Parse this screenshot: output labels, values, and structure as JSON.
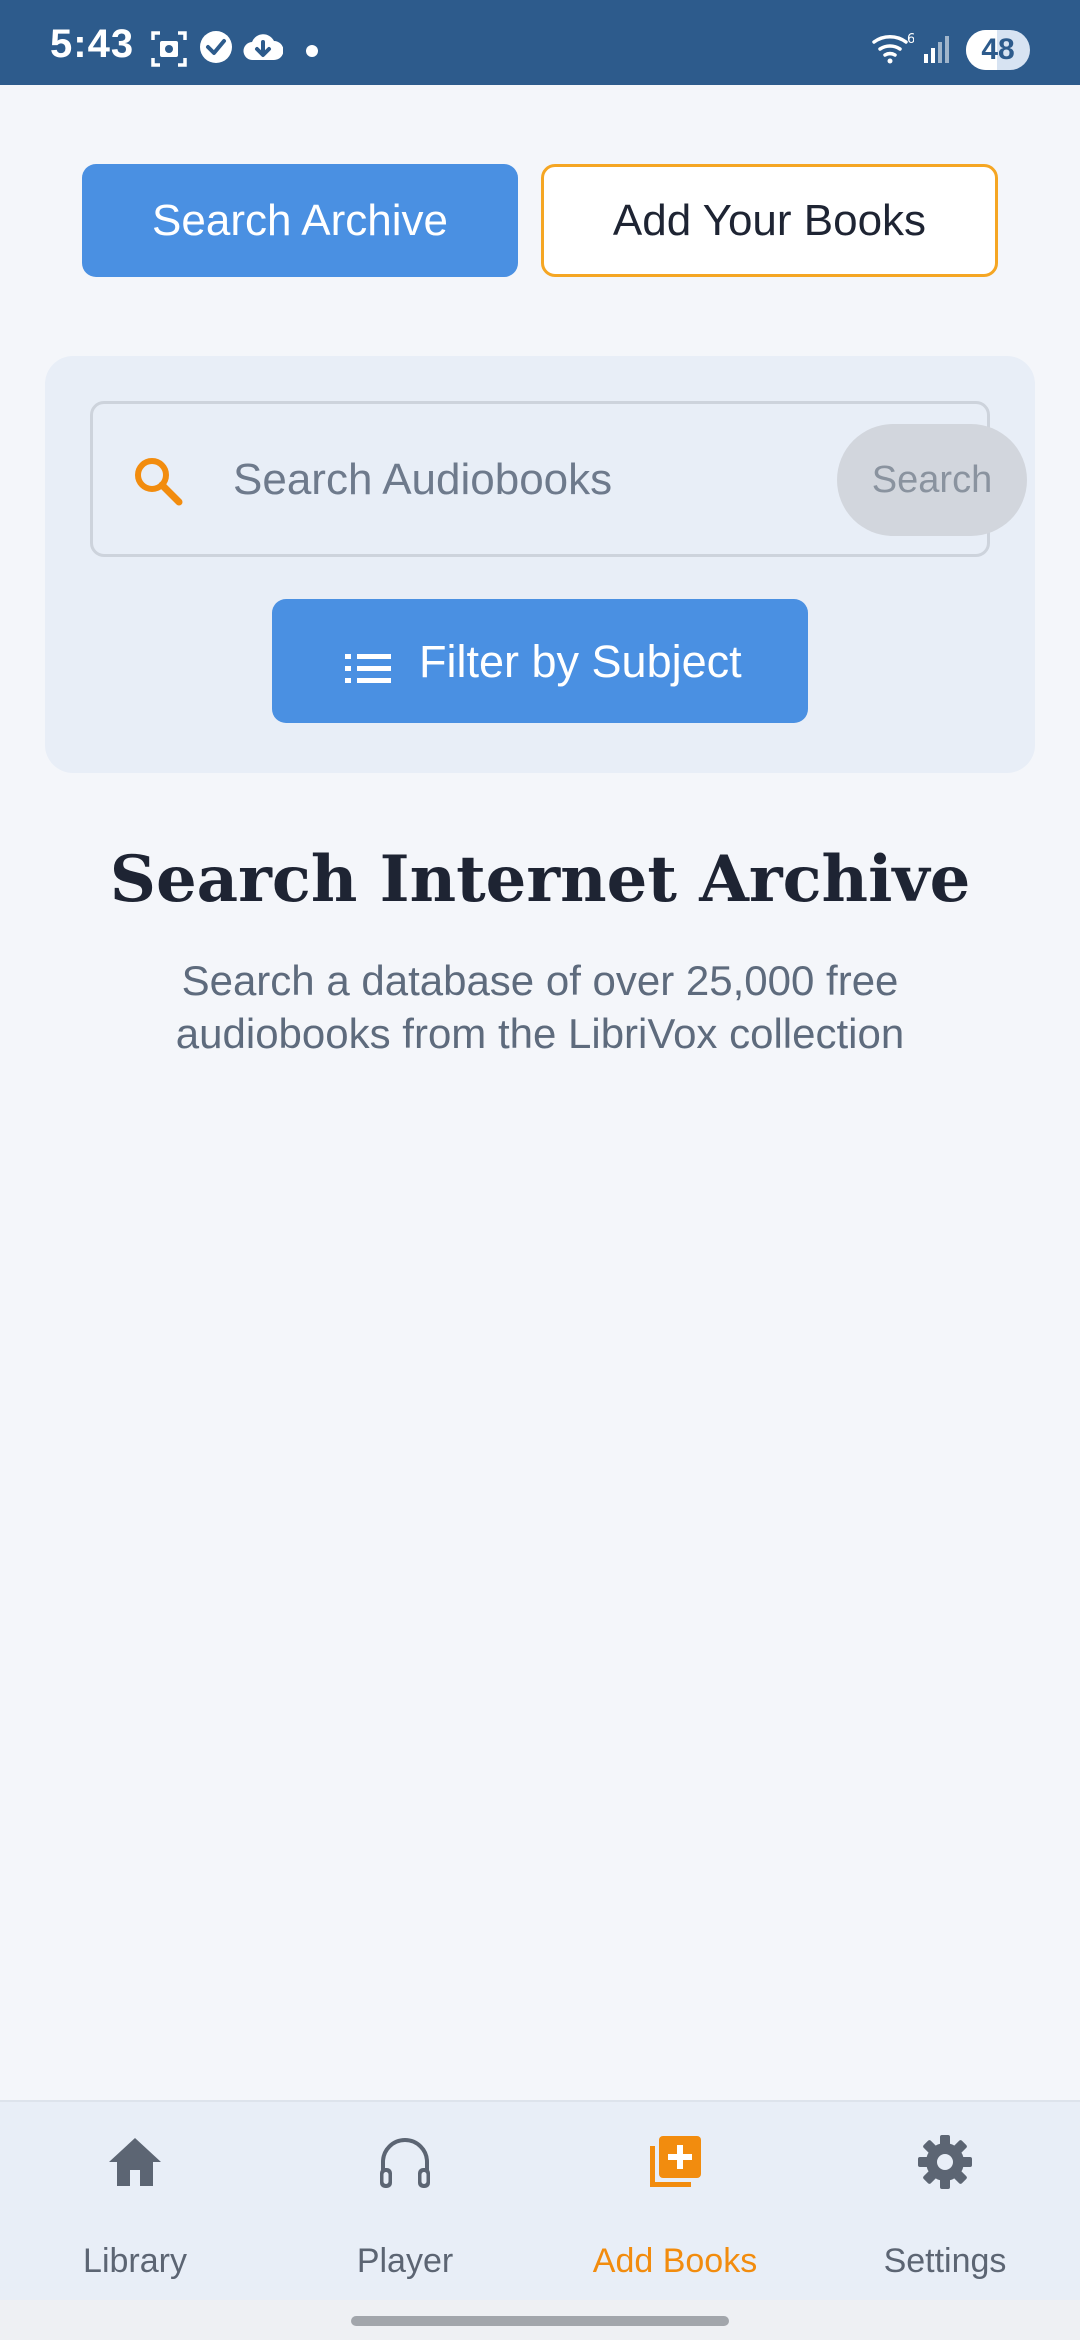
{
  "status_bar": {
    "time": "5:43",
    "battery": "48",
    "battery_level_percent": 48
  },
  "tabs": {
    "search_archive": "Search Archive",
    "add_your_books": "Add Your Books"
  },
  "search": {
    "placeholder": "Search Audiobooks",
    "button": "Search",
    "filter_button": "Filter by Subject"
  },
  "intro": {
    "title": "Search Internet Archive",
    "description": "Search a database of over 25,000 free audiobooks from the LibriVox collection"
  },
  "bottom_nav": {
    "items": [
      {
        "label": "Library",
        "icon": "home-icon"
      },
      {
        "label": "Player",
        "icon": "headphones-icon"
      },
      {
        "label": "Add Books",
        "icon": "add-library-icon",
        "active": true
      },
      {
        "label": "Settings",
        "icon": "gear-icon"
      }
    ]
  },
  "colors": {
    "status_bar": "#2D5B8C",
    "primary": "#4A90E2",
    "accent": "#F28C0E",
    "background": "#F4F6FA",
    "panel": "#E8EEF7"
  }
}
